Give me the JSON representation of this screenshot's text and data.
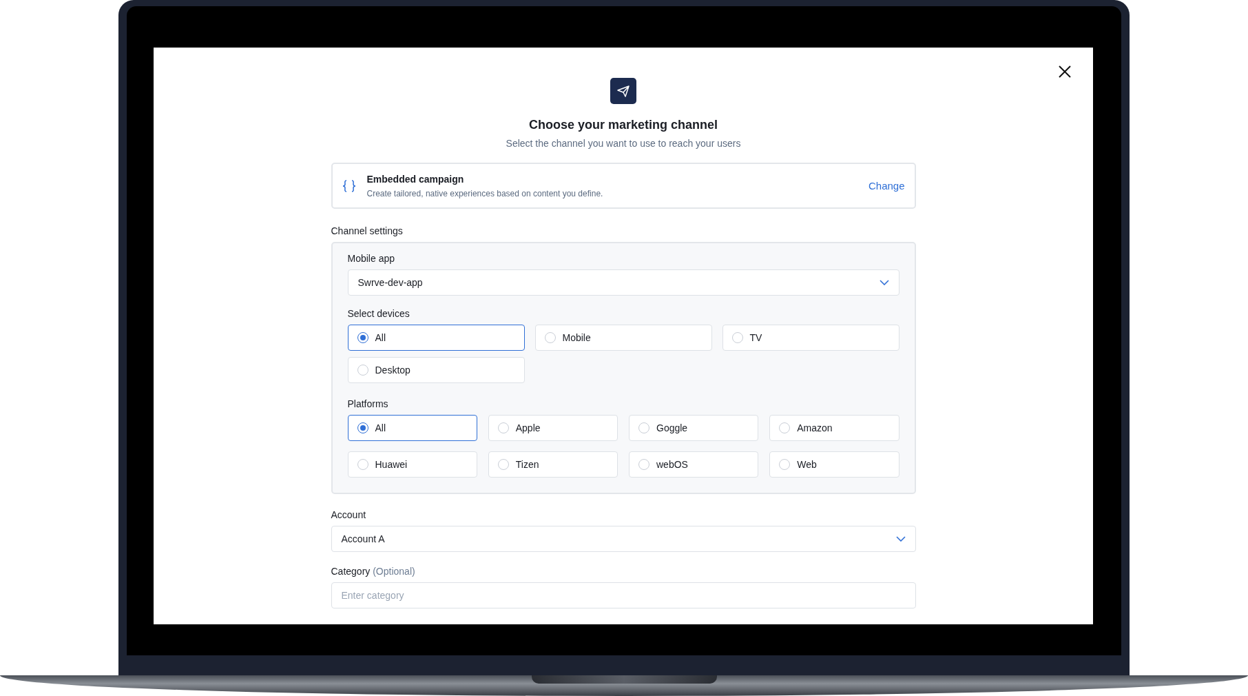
{
  "dialog": {
    "title": "Choose your marketing channel",
    "subtitle": "Select the channel you want to use to reach your users",
    "channel": {
      "name": "Embedded campaign",
      "description": "Create tailored, native experiences based on content you define.",
      "action": "Change"
    },
    "settings_heading": "Channel settings",
    "mobile_app": {
      "label": "Mobile app",
      "value": "Swrve-dev-app"
    },
    "devices": {
      "label": "Select devices",
      "options": [
        {
          "label": "All",
          "selected": true
        },
        {
          "label": "Mobile",
          "selected": false
        },
        {
          "label": "TV",
          "selected": false
        },
        {
          "label": "Desktop",
          "selected": false
        }
      ]
    },
    "platforms": {
      "label": "Platforms",
      "options": [
        {
          "label": "All",
          "selected": true
        },
        {
          "label": "Apple",
          "selected": false
        },
        {
          "label": "Goggle",
          "selected": false
        },
        {
          "label": "Amazon",
          "selected": false
        },
        {
          "label": "Huawei",
          "selected": false
        },
        {
          "label": "Tizen",
          "selected": false
        },
        {
          "label": "webOS",
          "selected": false
        },
        {
          "label": "Web",
          "selected": false
        }
      ]
    },
    "account": {
      "label": "Account",
      "value": "Account A"
    },
    "category": {
      "label": "Category",
      "hint": "(Optional)",
      "placeholder": "Enter category"
    }
  }
}
